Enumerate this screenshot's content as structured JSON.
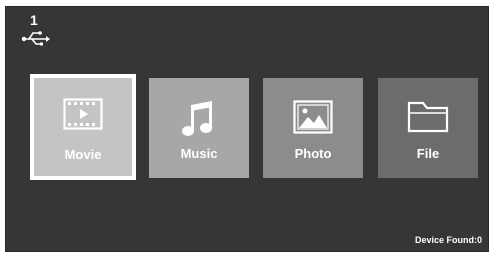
{
  "usb": {
    "count": "1",
    "icon": "usb-icon"
  },
  "tiles": [
    {
      "label": "Movie",
      "icon": "film-icon",
      "selected": true,
      "color": "#c4c4c4"
    },
    {
      "label": "Music",
      "icon": "music-note-icon",
      "selected": false,
      "color": "#a7a7a7"
    },
    {
      "label": "Photo",
      "icon": "image-icon",
      "selected": false,
      "color": "#8c8c8c"
    },
    {
      "label": "File",
      "icon": "folder-icon",
      "selected": false,
      "color": "#6c6c6c"
    }
  ],
  "status": {
    "device_found": "Device Found:0"
  },
  "colors": {
    "background": "#363636",
    "selection_border": "#ffffff",
    "text": "#ffffff"
  }
}
